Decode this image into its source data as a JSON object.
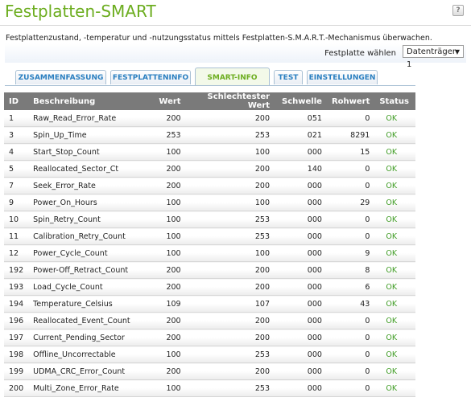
{
  "page": {
    "title": "Festplatten-SMART",
    "help_label": "?",
    "description": "Festplattenzustand, -temperatur und -nutzungsstatus mittels Festplatten-S.M.A.R.T.-Mechanismus überwachen."
  },
  "disk_select": {
    "label": "Festplatte wählen",
    "value": "Datenträger 1"
  },
  "tabs": [
    {
      "label": "ZUSAMMENFASSUNG"
    },
    {
      "label": "FESTPLATTENINFO"
    },
    {
      "label": "SMART-INFO"
    },
    {
      "label": "TEST"
    },
    {
      "label": "EINSTELLUNGEN"
    }
  ],
  "active_tab": "SMART-INFO",
  "table": {
    "headers": [
      "ID",
      "Beschreibung",
      "Wert",
      "Schlechtester Wert",
      "Schwelle",
      "Rohwert",
      "Status"
    ],
    "rows": [
      [
        "1",
        "Raw_Read_Error_Rate",
        "200",
        "200",
        "051",
        "0",
        "OK"
      ],
      [
        "3",
        "Spin_Up_Time",
        "253",
        "253",
        "021",
        "8291",
        "OK"
      ],
      [
        "4",
        "Start_Stop_Count",
        "100",
        "100",
        "000",
        "15",
        "OK"
      ],
      [
        "5",
        "Reallocated_Sector_Ct",
        "200",
        "200",
        "140",
        "0",
        "OK"
      ],
      [
        "7",
        "Seek_Error_Rate",
        "200",
        "200",
        "000",
        "0",
        "OK"
      ],
      [
        "9",
        "Power_On_Hours",
        "100",
        "100",
        "000",
        "29",
        "OK"
      ],
      [
        "10",
        "Spin_Retry_Count",
        "100",
        "253",
        "000",
        "0",
        "OK"
      ],
      [
        "11",
        "Calibration_Retry_Count",
        "100",
        "253",
        "000",
        "0",
        "OK"
      ],
      [
        "12",
        "Power_Cycle_Count",
        "100",
        "100",
        "000",
        "9",
        "OK"
      ],
      [
        "192",
        "Power-Off_Retract_Count",
        "200",
        "200",
        "000",
        "8",
        "OK"
      ],
      [
        "193",
        "Load_Cycle_Count",
        "200",
        "200",
        "000",
        "6",
        "OK"
      ],
      [
        "194",
        "Temperature_Celsius",
        "109",
        "107",
        "000",
        "43",
        "OK"
      ],
      [
        "196",
        "Reallocated_Event_Count",
        "200",
        "200",
        "000",
        "0",
        "OK"
      ],
      [
        "197",
        "Current_Pending_Sector",
        "200",
        "200",
        "000",
        "0",
        "OK"
      ],
      [
        "198",
        "Offline_Uncorrectable",
        "100",
        "253",
        "000",
        "0",
        "OK"
      ],
      [
        "199",
        "UDMA_CRC_Error_Count",
        "200",
        "200",
        "000",
        "0",
        "OK"
      ],
      [
        "200",
        "Multi_Zone_Error_Rate",
        "100",
        "253",
        "000",
        "0",
        "OK"
      ]
    ]
  },
  "colors": {
    "title_green": "#6cad1f",
    "tab_blue": "#2a7fc0",
    "header_gray": "#7a7a7a",
    "status_ok_green": "#3f9c24"
  }
}
